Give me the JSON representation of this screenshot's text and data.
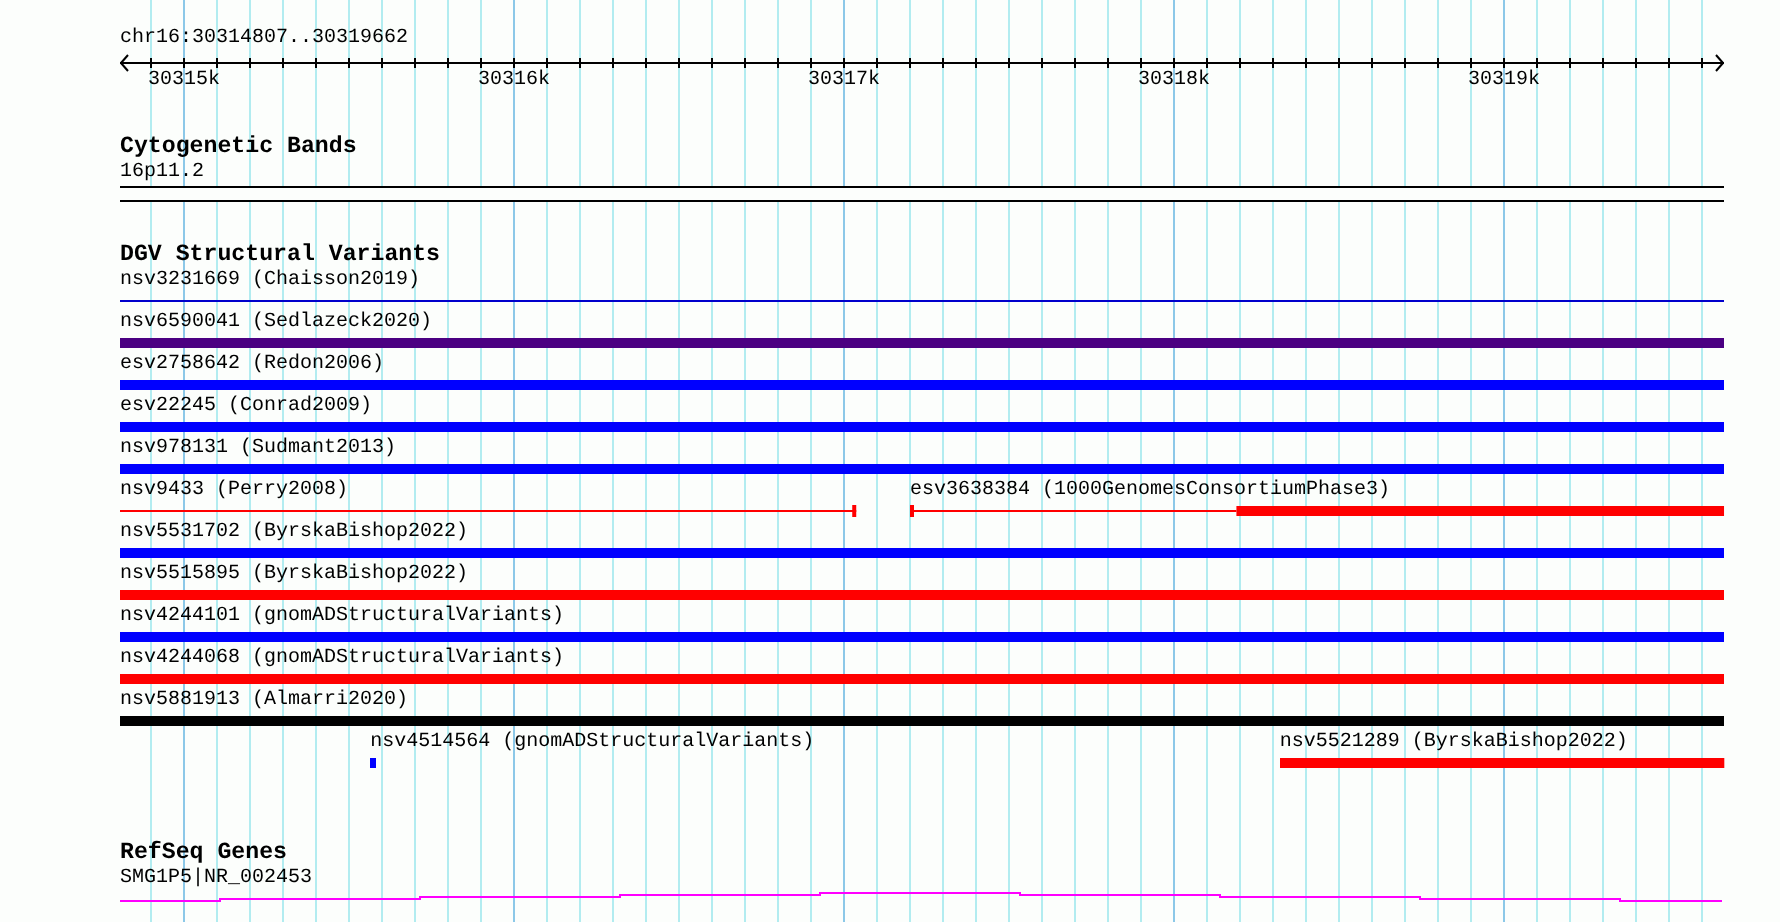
{
  "ruler": {
    "region": "chr16:30314807..30319662",
    "tick_labels": [
      "30315k",
      "30316k",
      "30317k",
      "30318k",
      "30319k"
    ]
  },
  "tracks": [
    {
      "kind": "cytoband",
      "title": "Cytogenetic Bands",
      "label": "16p11.2"
    },
    {
      "kind": "variants",
      "title": "DGV Structural Variants",
      "rows": [
        {
          "features": [
            {
              "label": "nsv3231669 (Chaisson2019)",
              "color": "#0000cc",
              "kind": "line"
            }
          ]
        },
        {
          "features": [
            {
              "label": "nsv6590041 (Sedlazeck2020)",
              "color": "#4b0082",
              "kind": "bar"
            }
          ]
        },
        {
          "features": [
            {
              "label": "esv2758642 (Redon2006)",
              "color": "#0000ff",
              "kind": "bar"
            }
          ]
        },
        {
          "features": [
            {
              "label": "esv22245 (Conrad2009)",
              "color": "#0000ff",
              "kind": "bar"
            }
          ]
        },
        {
          "features": [
            {
              "label": "nsv978131 (Sudmant2013)",
              "color": "#0000ff",
              "kind": "bar"
            }
          ]
        },
        {
          "features": [
            {
              "label": "nsv9433 (Perry2008)",
              "color": "#ff0000",
              "kind": "line"
            },
            {
              "label": "esv3638384 (1000GenomesConsortiumPhase3)",
              "color": "#ff0000",
              "kind": "line-bar"
            }
          ]
        },
        {
          "features": [
            {
              "label": "nsv5531702 (ByrskaBishop2022)",
              "color": "#0000ff",
              "kind": "bar"
            }
          ]
        },
        {
          "features": [
            {
              "label": "nsv5515895 (ByrskaBishop2022)",
              "color": "#ff0000",
              "kind": "bar"
            }
          ]
        },
        {
          "features": [
            {
              "label": "nsv4244101 (gnomADStructuralVariants)",
              "color": "#0000ff",
              "kind": "bar"
            }
          ]
        },
        {
          "features": [
            {
              "label": "nsv4244068 (gnomADStructuralVariants)",
              "color": "#ff0000",
              "kind": "bar"
            }
          ]
        },
        {
          "features": [
            {
              "label": "nsv5881913 (Almarri2020)",
              "color": "#000000",
              "kind": "bar"
            }
          ]
        },
        {
          "features": [
            {
              "label": "nsv4514564 (gnomADStructuralVariants)",
              "color": "#0000ff",
              "kind": "bar"
            },
            {
              "label": "nsv5521289 (ByrskaBishop2022)",
              "color": "#ff0000",
              "kind": "bar"
            }
          ]
        }
      ]
    },
    {
      "kind": "gene",
      "title": "RefSeq Genes",
      "label": "SMG1P5|NR_002453"
    }
  ]
}
